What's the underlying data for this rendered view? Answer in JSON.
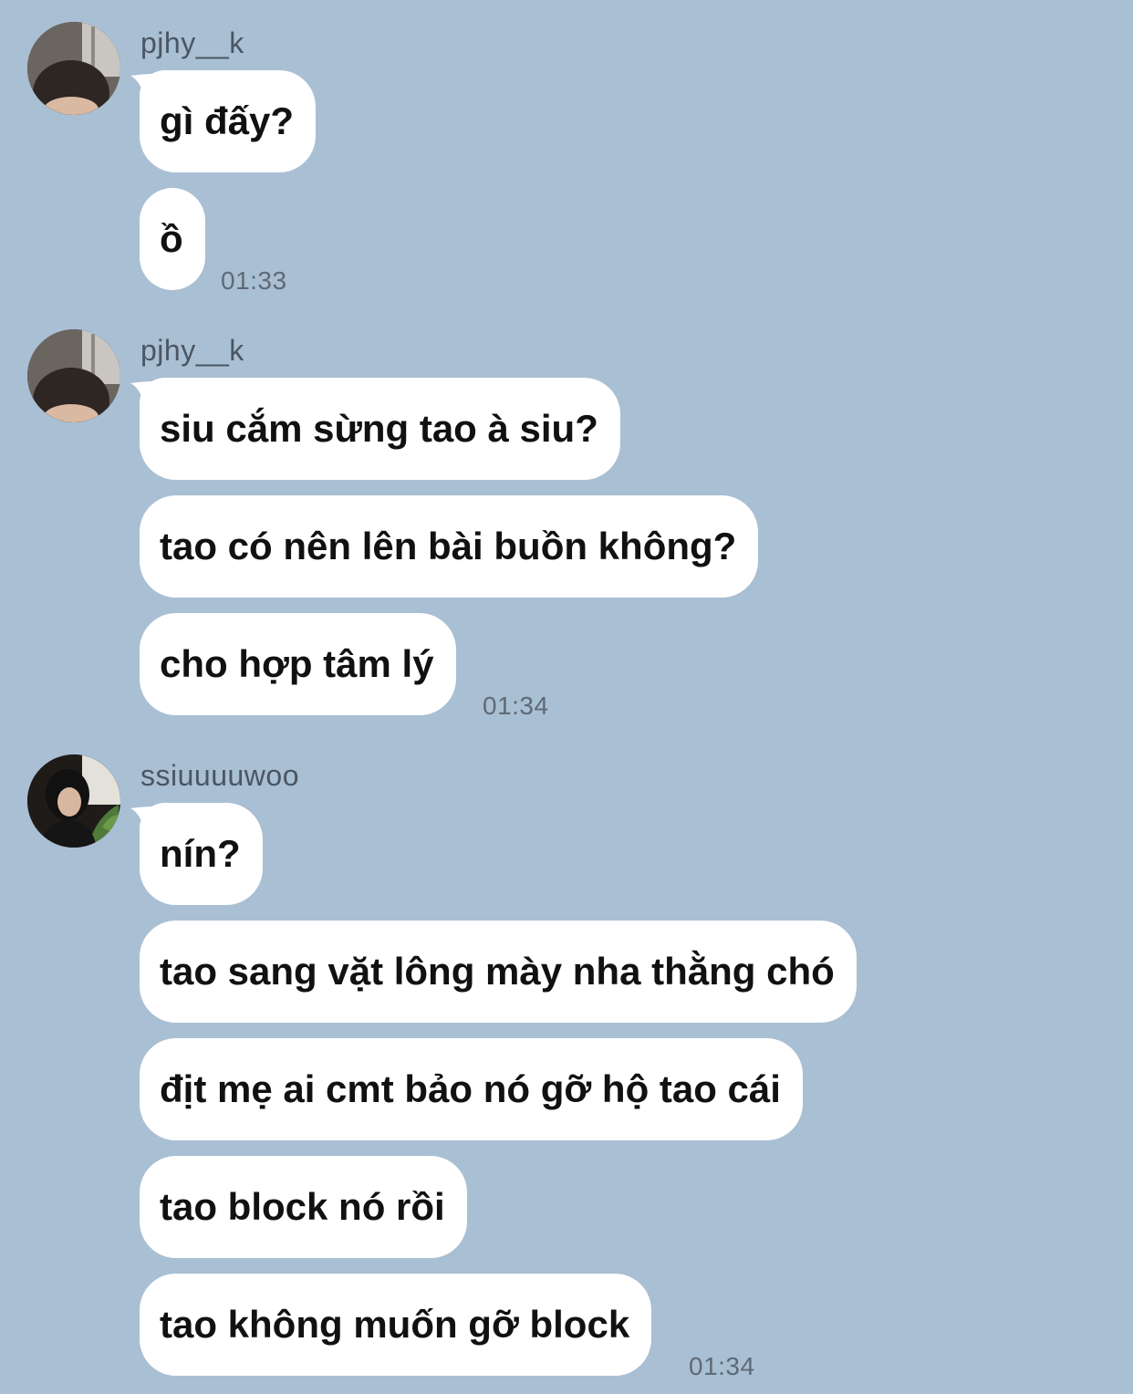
{
  "groups": [
    {
      "sender": "pjhy__k",
      "avatar": "user-avatar-photo",
      "messages": [
        "gì đấy?",
        "ồ"
      ],
      "time": "01:33"
    },
    {
      "sender": "pjhy__k",
      "avatar": "user-avatar-photo",
      "messages": [
        "siu cắm sừng tao à siu?",
        "tao có nên lên bài buồn không?",
        "cho hợp tâm lý"
      ],
      "time": "01:34"
    },
    {
      "sender": "ssiuuuuwoo",
      "avatar": "user-avatar-photo",
      "messages": [
        "nín?",
        "tao sang vặt lông mày nha thằng chó",
        "địt mẹ ai cmt bảo nó gỡ hộ tao cái",
        "tao block nó rồi",
        "tao không muốn gỡ block"
      ],
      "time": "01:34"
    }
  ],
  "colors": {
    "background": "#a9bfd3",
    "bubble": "#ffffff",
    "text": "#111111",
    "meta": "#5e6a76"
  }
}
